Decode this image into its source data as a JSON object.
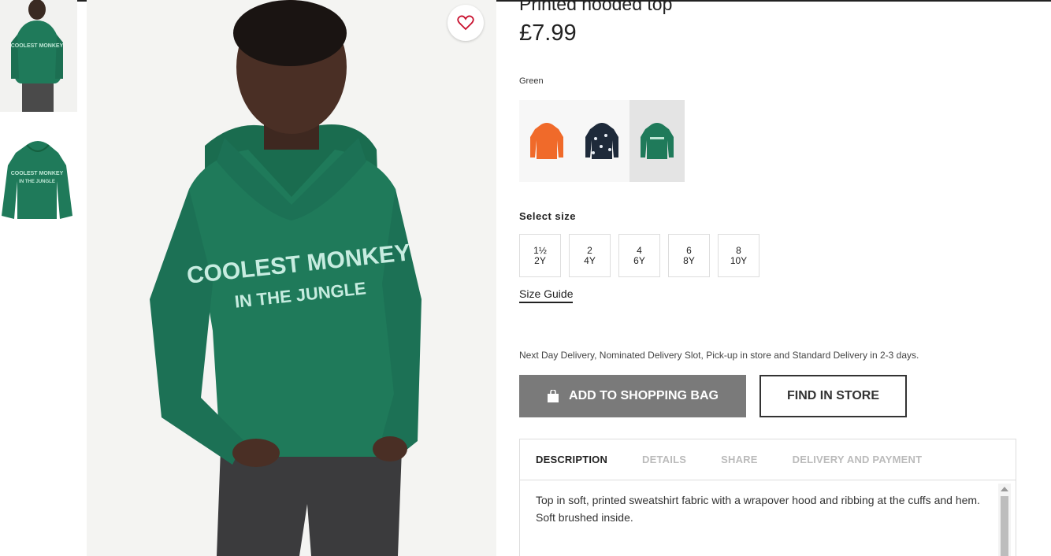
{
  "product": {
    "title": "Printed hooded top",
    "price": "£7.99"
  },
  "color": {
    "label": "Green",
    "swatches": [
      {
        "name": "orange",
        "hex": "#f06a2a"
      },
      {
        "name": "navy",
        "hex": "#1e2a3a"
      },
      {
        "name": "green",
        "hex": "#1f7a5a",
        "selected": true
      }
    ]
  },
  "sizes": {
    "label": "Select size",
    "options": [
      {
        "top": "1½",
        "bottom": "2Y"
      },
      {
        "top": "2",
        "bottom": "4Y"
      },
      {
        "top": "4",
        "bottom": "6Y"
      },
      {
        "top": "6",
        "bottom": "8Y"
      },
      {
        "top": "8",
        "bottom": "10Y"
      }
    ],
    "guide": "Size Guide"
  },
  "delivery": {
    "text": "Next Day Delivery, Nominated Delivery Slot, Pick-up in store and Standard Delivery in 2-3 days."
  },
  "actions": {
    "add_to_bag": "ADD TO SHOPPING BAG",
    "find_in_store": "FIND IN STORE"
  },
  "tabs": {
    "items": [
      {
        "label": "DESCRIPTION",
        "active": true
      },
      {
        "label": "DETAILS"
      },
      {
        "label": "SHARE"
      },
      {
        "label": "DELIVERY AND PAYMENT"
      }
    ],
    "description": "Top in soft, printed sweatshirt fabric with a wrapover hood and ribbing at the cuffs and hem. Soft brushed inside."
  },
  "image": {
    "print_line1": "COOLEST MONKEY",
    "print_line2": "IN THE JUNGLE"
  },
  "colors": {
    "hoodie": "#1f7a5a",
    "button_gray": "#7a7a7a"
  }
}
